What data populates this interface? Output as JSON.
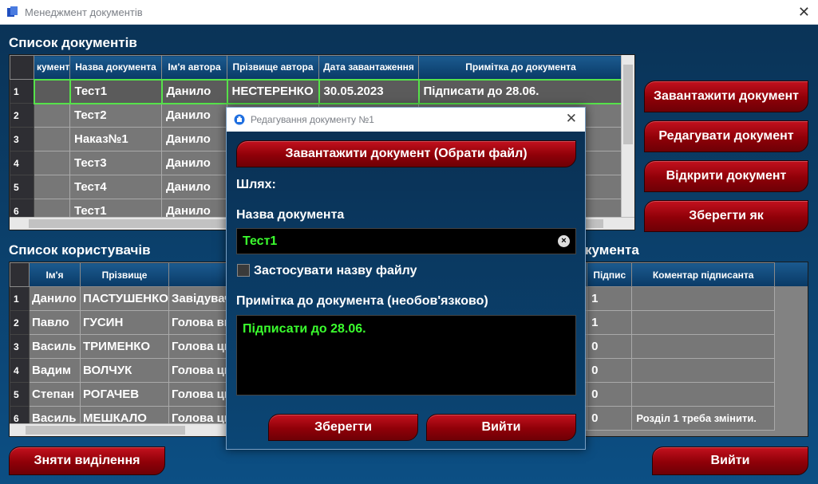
{
  "window": {
    "title": "Менеджмент документів",
    "close": "✕"
  },
  "documents": {
    "section_title": "Список документів",
    "columns": [
      "кумента",
      "Назва документа",
      "Ім'я автора",
      "Прізвище автора",
      "Дата завантаження",
      "Примітка до документа"
    ],
    "rows": [
      {
        "n": "1",
        "c0": "",
        "name": "Тест1",
        "first": "Данило",
        "last": "НЕСТЕРЕНКО",
        "date": "30.05.2023",
        "note": "Підписати до 28.06."
      },
      {
        "n": "2",
        "c0": "",
        "name": "Тест2",
        "first": "Данило",
        "last": "",
        "date": "",
        "note": ""
      },
      {
        "n": "3",
        "c0": "",
        "name": "Наказ№1",
        "first": "Данило",
        "last": "",
        "date": "",
        "note": ""
      },
      {
        "n": "4",
        "c0": "",
        "name": "Тест3",
        "first": "Данило",
        "last": "",
        "date": "",
        "note": ""
      },
      {
        "n": "5",
        "c0": "",
        "name": "Тест4",
        "first": "Данило",
        "last": "",
        "date": "",
        "note": ""
      },
      {
        "n": "6",
        "c0": "",
        "name": "Тест1",
        "first": "Данило",
        "last": "",
        "date": "",
        "note": ""
      }
    ]
  },
  "users": {
    "section_title": "Список користувачів",
    "columns": [
      "Ім'я",
      "Прізвище",
      ""
    ],
    "rows": [
      {
        "n": "1",
        "first": "Данило",
        "last": "ПАСТУШЕНКО",
        "pos": "Завідувач"
      },
      {
        "n": "2",
        "first": "Павло",
        "last": "ГУСИН",
        "pos": "Голова ви"
      },
      {
        "n": "3",
        "first": "Василь",
        "last": "ТРИМЕНКО",
        "pos": "Голова ци"
      },
      {
        "n": "4",
        "first": "Вадим",
        "last": "ВОЛЧУК",
        "pos": "Голова ци"
      },
      {
        "n": "5",
        "first": "Степан",
        "last": "РОГАЧЕВ",
        "pos": "Голова ци"
      },
      {
        "n": "6",
        "first": "Василь",
        "last": "МЕШКАЛО",
        "pos": "Голова ци"
      }
    ]
  },
  "signers": {
    "section_title": "кумента",
    "columns": [
      "Підпис",
      "Коментар підписанта"
    ],
    "rows": [
      {
        "sign": "1",
        "comment": ""
      },
      {
        "sign": "1",
        "comment": ""
      },
      {
        "sign": "0",
        "comment": ""
      },
      {
        "sign": "0",
        "comment": ""
      },
      {
        "sign": "0",
        "comment": ""
      },
      {
        "sign": "0",
        "comment": "Розділ 1 треба змінити."
      }
    ]
  },
  "buttons": {
    "upload": "Завантажити документ",
    "edit": "Редагувати документ",
    "open": "Відкрити документ",
    "save_as": "Зберегти як",
    "clear_selection": "Зняти виділення",
    "exit": "Вийти"
  },
  "dialog": {
    "title": "Редагування документу №1",
    "close": "✕",
    "upload_button": "Завантажити документ (Обрати файл)",
    "path_label": "Шлях:",
    "name_label": "Назва документа",
    "name_value": "Тест1",
    "use_filename_label": "Застосувати назву файлу",
    "note_label": "Примітка до документа (необов'язково)",
    "note_value": "Підписати до 28.06.",
    "save_button": "Зберегти",
    "exit_button": "Вийти"
  },
  "colors": {
    "accent_green": "#3bff2e",
    "button_red": "#8f0008",
    "background": "#0b3f6a"
  }
}
